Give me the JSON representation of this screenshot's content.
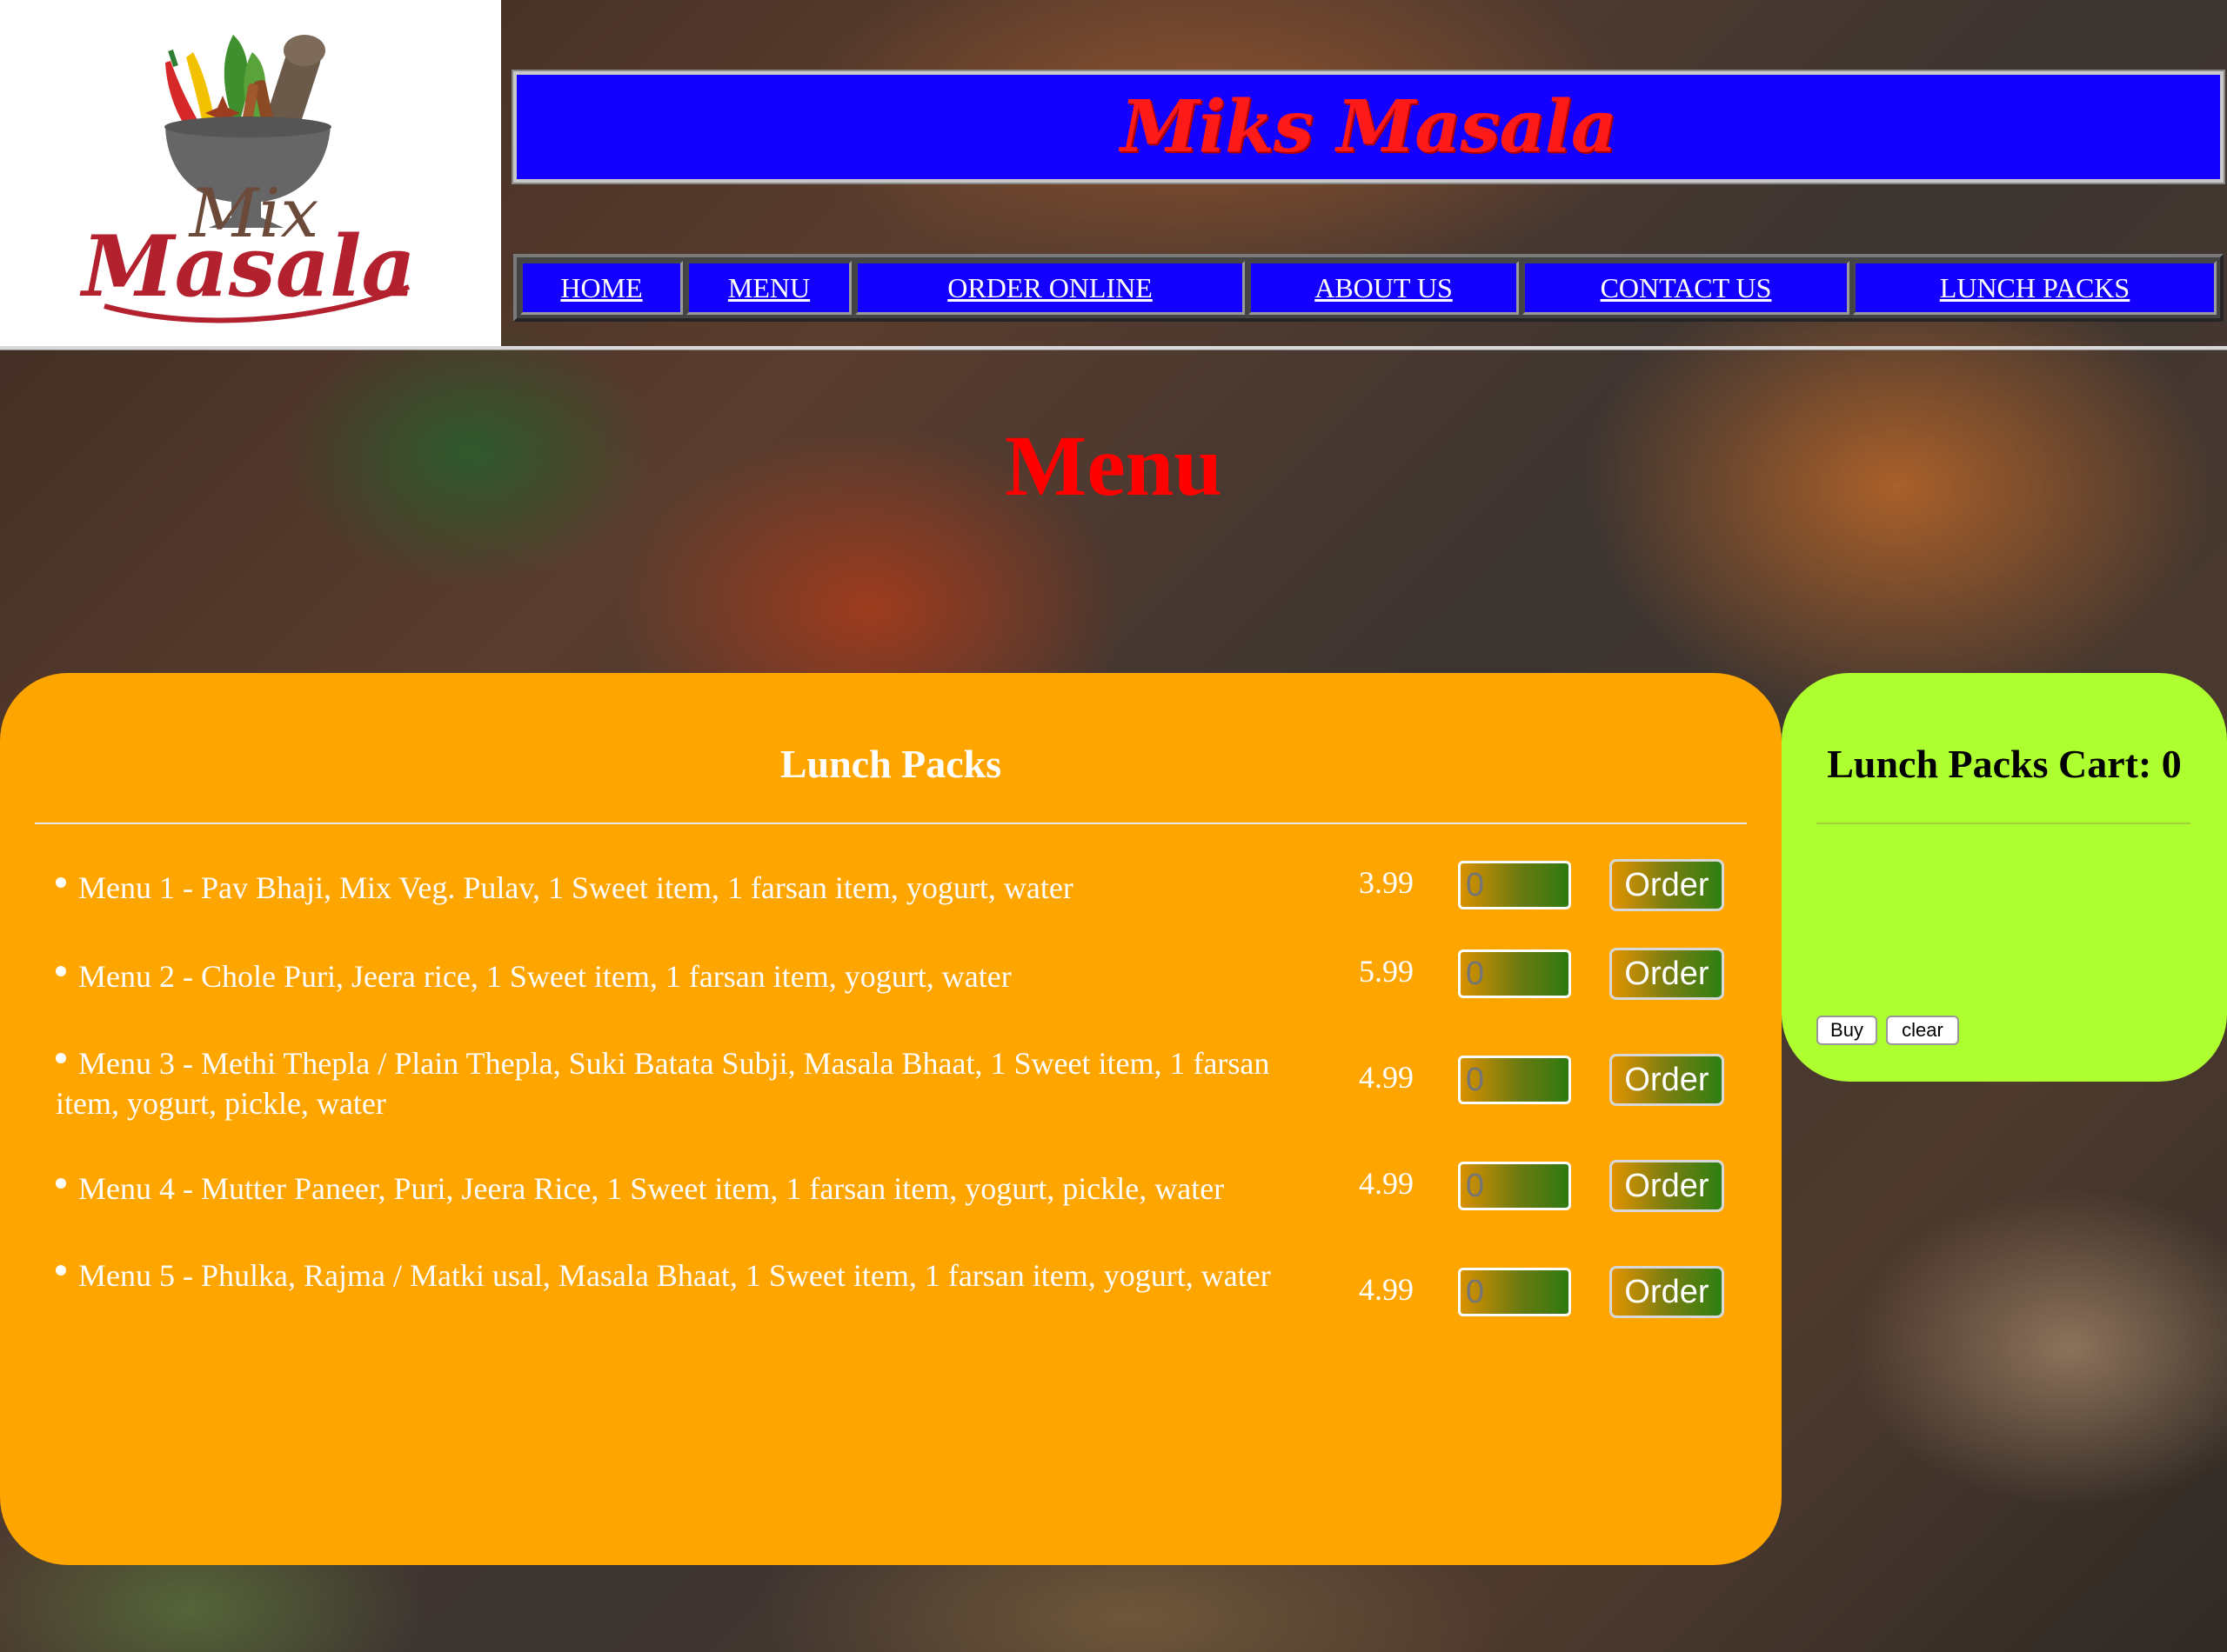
{
  "header": {
    "logo_text_top": "Mix",
    "logo_text_bottom": "Masala",
    "site_title": "Miks Masala"
  },
  "nav": [
    {
      "label": "HOME"
    },
    {
      "label": "MENU"
    },
    {
      "label": "ORDER ONLINE"
    },
    {
      "label": "ABOUT US"
    },
    {
      "label": "CONTACT US"
    },
    {
      "label": "LUNCH PACKS"
    }
  ],
  "page": {
    "heading": "Menu"
  },
  "menu_panel": {
    "heading": "Lunch Packs",
    "order_label": "Order",
    "items": [
      {
        "description": "Menu 1 - Pav Bhaji, Mix Veg. Pulav, 1 Sweet item, 1 farsan item, yogurt, water",
        "price": "3.99",
        "quantity_placeholder": "0"
      },
      {
        "description": "Menu 2 - Chole Puri, Jeera rice, 1 Sweet item, 1 farsan item, yogurt, water",
        "price": "5.99",
        "quantity_placeholder": "0"
      },
      {
        "description": "Menu 3 - Methi Thepla / Plain Thepla, Suki Batata Subji, Masala Bhaat, 1 Sweet item, 1 farsan item, yogurt, pickle, water",
        "price": "4.99",
        "quantity_placeholder": "0"
      },
      {
        "description": "Menu 4 - Mutter Paneer, Puri, Jeera Rice, 1 Sweet item, 1 farsan item, yogurt, pickle, water",
        "price": "4.99",
        "quantity_placeholder": "0"
      },
      {
        "description": "Menu 5 - Phulka, Rajma / Matki usal, Masala Bhaat, 1 Sweet item, 1 farsan item, yogurt, water",
        "price": "4.99",
        "quantity_placeholder": "0"
      }
    ]
  },
  "cart": {
    "heading": "Lunch Packs Cart: 0",
    "buy_label": "Buy",
    "clear_label": "clear"
  },
  "colors": {
    "banner_blue": "#1400ff",
    "title_red": "#ff1a1a",
    "menu_panel_orange": "#ffa500",
    "cart_panel_green": "#adff2f"
  }
}
